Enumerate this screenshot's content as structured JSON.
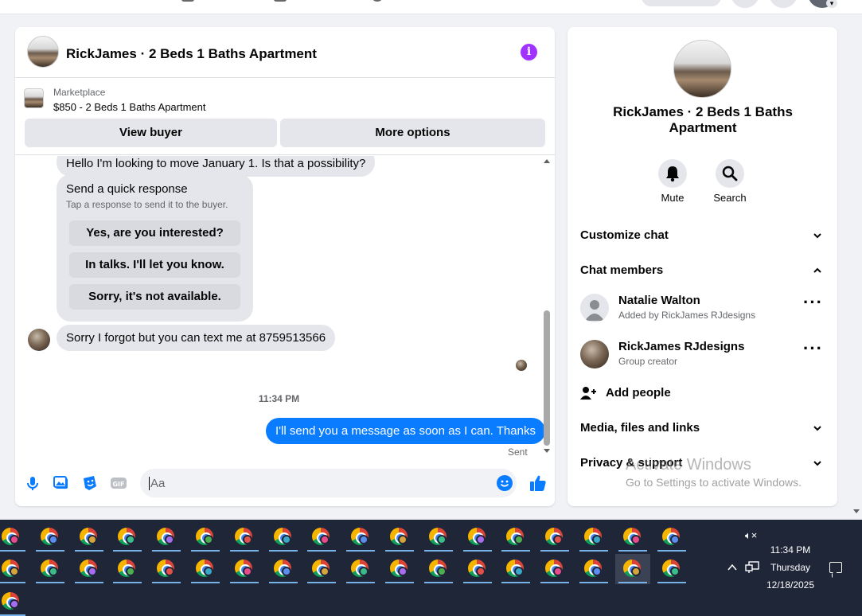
{
  "chat": {
    "title": "RickJames · 2 Beds 1 Baths Apartment",
    "listing": {
      "source": "Marketplace",
      "title": "$850 - 2 Beds 1 Baths Apartment",
      "view_buyer": "View buyer",
      "more_options": "More options"
    },
    "messages": {
      "hello": "Hello I'm looking to move January 1. Is that a possibility?",
      "quick_title": "Send a quick response",
      "quick_sub": "Tap a response to send it to the buyer.",
      "quick_options": [
        "Yes, are you interested?",
        "In talks. I'll let you know.",
        "Sorry, it's not available."
      ],
      "sorry": "Sorry I forgot but you can text me at 8759513566",
      "time": "11:34 PM",
      "mine": "I'll send you a message as soon as I can. Thanks",
      "status": "Sent"
    },
    "composer_placeholder": "Aa"
  },
  "side": {
    "title": "RickJames · 2 Beds 1 Baths Apartment",
    "actions": [
      "Mute",
      "Search"
    ],
    "customize": "Customize chat",
    "members_heading": "Chat members",
    "members": [
      {
        "name": "Natalie Walton",
        "sub": "Added by RickJames RJdesigns"
      },
      {
        "name": "RickJames RJdesigns",
        "sub": "Group creator"
      }
    ],
    "add_people": "Add people",
    "media": "Media, files and links",
    "privacy": "Privacy & support"
  },
  "watermark": {
    "line1": "Activate Windows",
    "line2": "Go to Settings to activate Windows."
  },
  "taskbar": {
    "time": "11:34 PM",
    "day": "Thursday",
    "date": "12/18/2025",
    "badge_colors": [
      "#e94b8a",
      "#5b8def",
      "#d6a43b",
      "#3bbd8a",
      "#a66df0",
      "#4cae4f",
      "#e2504a",
      "#3aa7c7"
    ]
  },
  "colors": {
    "messenger_blue": "#0a7cff",
    "info_purple": "#a033ff",
    "taskbar_bg": "#1f2638"
  }
}
